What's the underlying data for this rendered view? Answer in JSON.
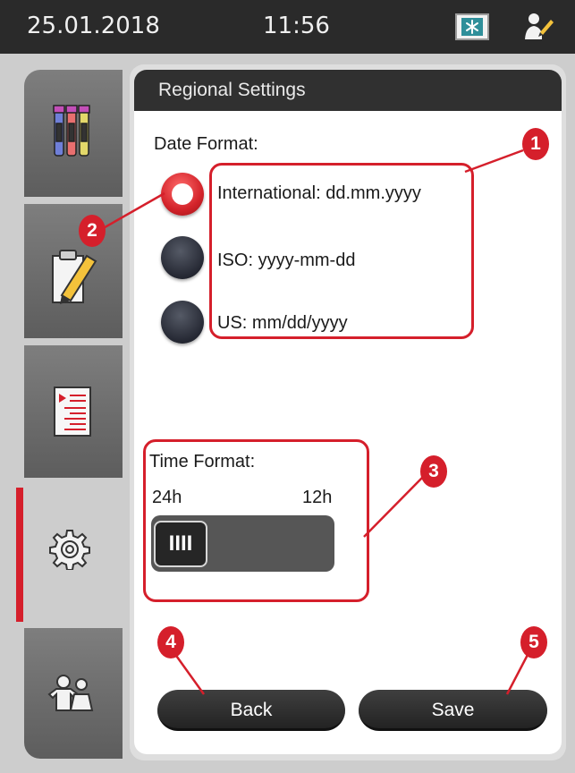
{
  "status_bar": {
    "date": "25.01.2018",
    "time": "11:56",
    "monitor_icon": "snowflake-monitor-icon",
    "user_icon": "user-pencil-icon"
  },
  "sidebar": {
    "tabs": [
      {
        "icon": "reagent-bottles-icon",
        "active": false
      },
      {
        "icon": "edit-document-icon",
        "active": false
      },
      {
        "icon": "program-list-icon",
        "active": false
      },
      {
        "icon": "settings-gear-icon",
        "active": true
      },
      {
        "icon": "users-icon",
        "active": false
      }
    ]
  },
  "panel": {
    "title": "Regional Settings",
    "date_format_label": "Date Format:",
    "date_options": [
      {
        "label": "International: dd.mm.yyyy",
        "selected": true
      },
      {
        "label": "ISO: yyyy-mm-dd",
        "selected": false
      },
      {
        "label": "US: mm/dd/yyyy",
        "selected": false
      }
    ],
    "time_format_label": "Time Format:",
    "time_24h": "24h",
    "time_12h": "12h",
    "time_selected": "24h",
    "slider_thumb_glyph": "IIII",
    "back_label": "Back",
    "save_label": "Save"
  },
  "callouts": [
    "1",
    "2",
    "3",
    "4",
    "5"
  ],
  "colors": {
    "accent": "#d51f2b",
    "title_bar": "#303030",
    "frame": "#cdcdcd"
  }
}
